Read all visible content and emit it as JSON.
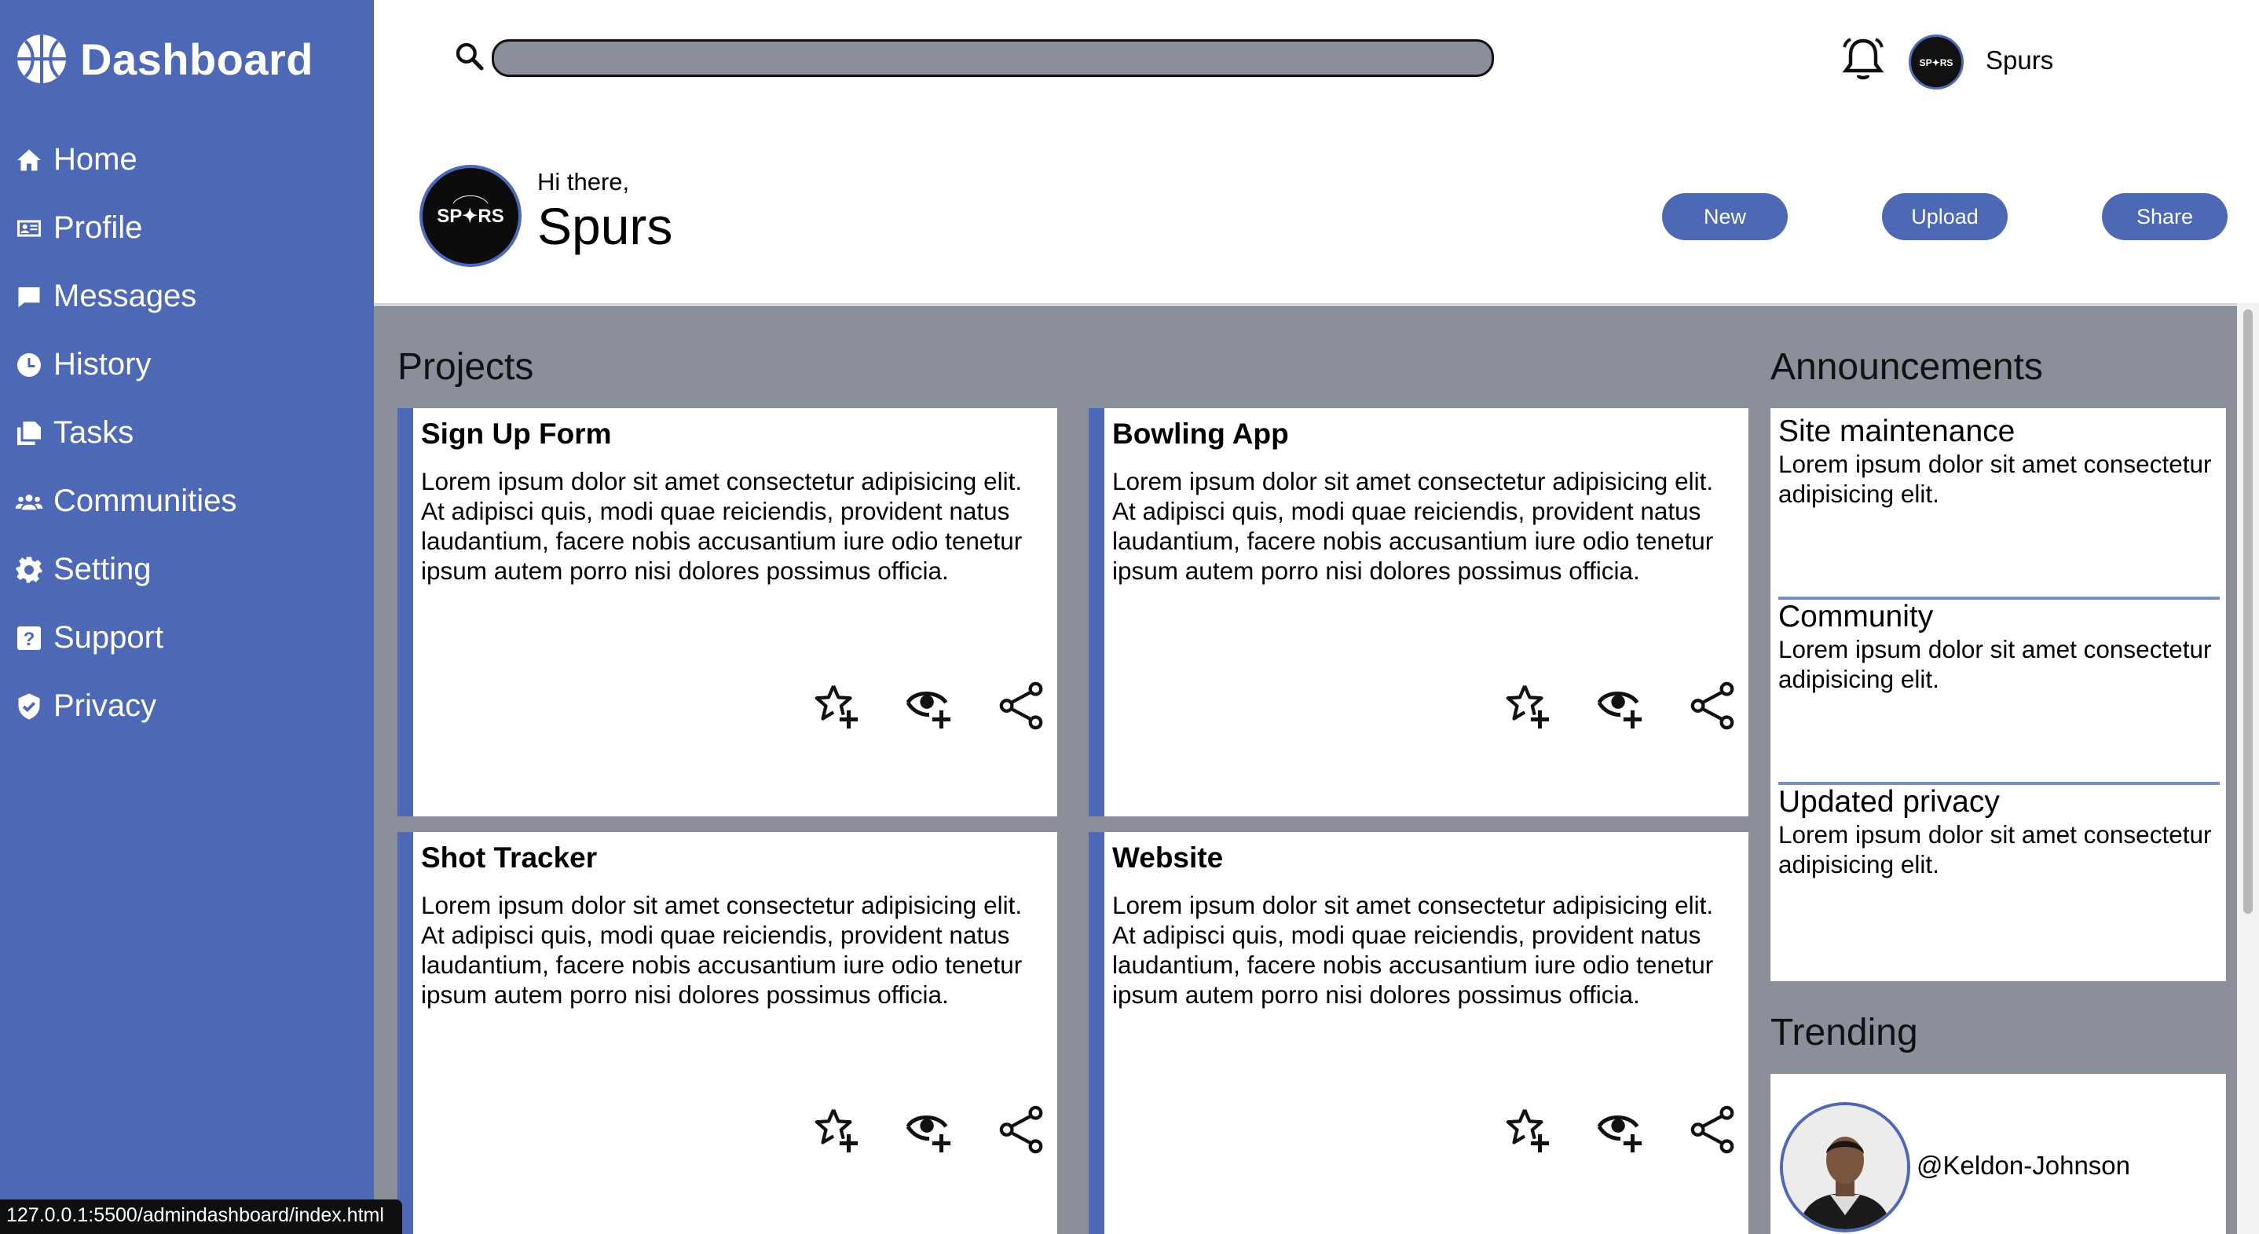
{
  "app": {
    "brand": "Dashboard"
  },
  "sidebar": {
    "items": [
      {
        "label": "Home",
        "icon": "home-icon"
      },
      {
        "label": "Profile",
        "icon": "id-card-icon"
      },
      {
        "label": "Messages",
        "icon": "chat-icon"
      },
      {
        "label": "History",
        "icon": "clock-icon"
      },
      {
        "label": "Tasks",
        "icon": "copy-icon"
      },
      {
        "label": "Communities",
        "icon": "people-icon"
      },
      {
        "label": "Setting",
        "icon": "gear-icon"
      },
      {
        "label": "Support",
        "icon": "question-icon"
      },
      {
        "label": "Privacy",
        "icon": "shield-icon"
      }
    ]
  },
  "header": {
    "search": {
      "placeholder": "",
      "value": ""
    },
    "user_name": "Spurs"
  },
  "greeting": {
    "hi": "Hi there,",
    "name": "Spurs",
    "buttons": {
      "new": "New",
      "upload": "Upload",
      "share": "Share"
    }
  },
  "projects": {
    "title": "Projects",
    "cards": [
      {
        "title": "Sign Up Form",
        "desc": "Lorem ipsum dolor sit amet consectetur adipisicing elit. At adipisci quis, modi quae reiciendis, provident natus laudantium, facere nobis accusantium iure odio tenetur ipsum autem porro nisi dolores possimus officia."
      },
      {
        "title": "Bowling App",
        "desc": "Lorem ipsum dolor sit amet consectetur adipisicing elit. At adipisci quis, modi quae reiciendis, provident natus laudantium, facere nobis accusantium iure odio tenetur ipsum autem porro nisi dolores possimus officia."
      },
      {
        "title": "Shot Tracker",
        "desc": "Lorem ipsum dolor sit amet consectetur adipisicing elit. At adipisci quis, modi quae reiciendis, provident natus laudantium, facere nobis accusantium iure odio tenetur ipsum autem porro nisi dolores possimus officia."
      },
      {
        "title": "Website",
        "desc": "Lorem ipsum dolor sit amet consectetur adipisicing elit. At adipisci quis, modi quae reiciendis, provident natus laudantium, facere nobis accusantium iure odio tenetur ipsum autem porro nisi dolores possimus officia."
      }
    ]
  },
  "announcements": {
    "title": "Announcements",
    "items": [
      {
        "title": "Site maintenance",
        "desc": "Lorem ipsum dolor sit amet consectetur adipisicing elit."
      },
      {
        "title": "Community",
        "desc": "Lorem ipsum dolor sit amet consectetur adipisicing elit."
      },
      {
        "title": "Updated privacy",
        "desc": "Lorem ipsum dolor sit amet consectetur adipisicing elit."
      }
    ]
  },
  "trending": {
    "title": "Trending",
    "handle": "@Keldon-Johnson"
  },
  "status_bar": {
    "url": "127.0.0.1:5500/admindashboard/index.html"
  },
  "colors": {
    "accent": "#4d68b5",
    "content_bg": "#8a8f99",
    "search_bg": "#8a8f99"
  }
}
